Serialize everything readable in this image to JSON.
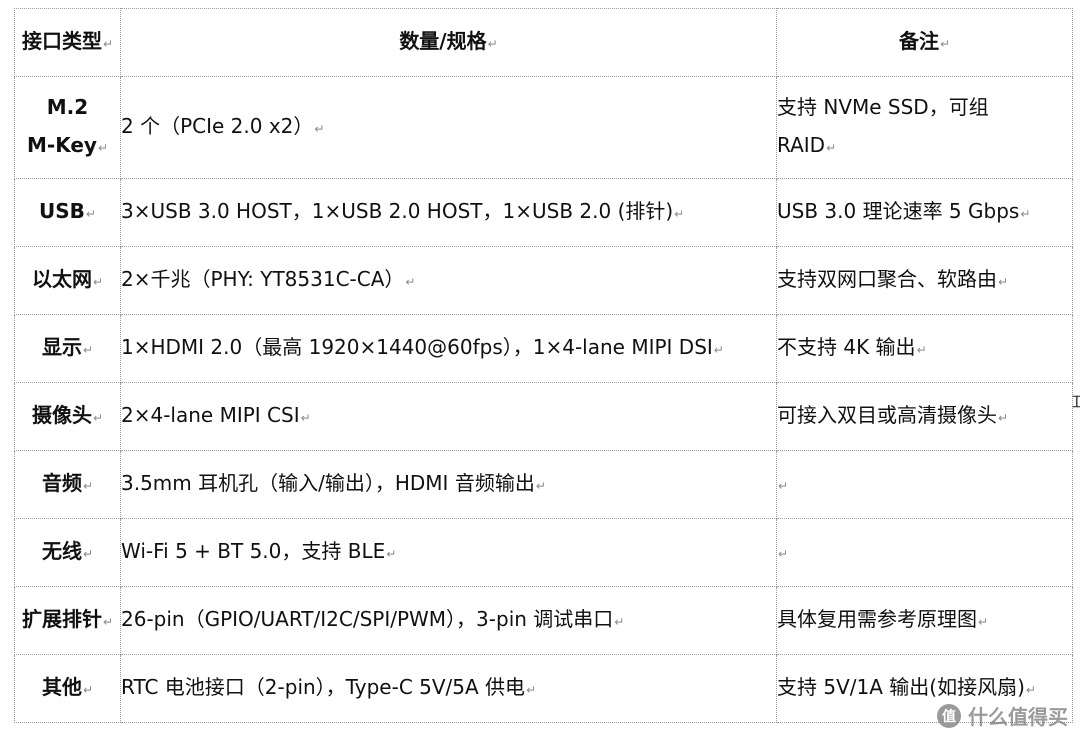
{
  "table": {
    "headers": [
      "接口类型",
      "数量/规格",
      "备注"
    ],
    "paragraph_mark": "↵",
    "rows": [
      {
        "type_lines": [
          "M.2",
          "M-Key"
        ],
        "spec": "2 个（PCIe 2.0 x2）",
        "note_lines": [
          "支持 NVMe SSD，可组",
          "RAID"
        ]
      },
      {
        "type_lines": [
          "USB"
        ],
        "spec": "3×USB 3.0 HOST，1×USB 2.0 HOST，1×USB 2.0 (排针)",
        "note_lines": [
          "USB 3.0  理论速率 5 Gbps"
        ]
      },
      {
        "type_lines": [
          "以太网"
        ],
        "spec": "2×千兆（PHY: YT8531C-CA）",
        "note_lines": [
          "支持双网口聚合、软路由"
        ]
      },
      {
        "type_lines": [
          "显示"
        ],
        "spec": "1×HDMI 2.0（最高 1920×1440@60fps），1×4-lane MIPI DSI",
        "note_lines": [
          "不支持  4K  输出"
        ]
      },
      {
        "type_lines": [
          "摄像头"
        ],
        "spec": "2×4-lane MIPI CSI",
        "note_lines": [
          "可接入双目或高清摄像头"
        ]
      },
      {
        "type_lines": [
          "音频"
        ],
        "spec": "3.5mm  耳机孔（输入/输出），HDMI  音频输出",
        "note_lines": [
          ""
        ]
      },
      {
        "type_lines": [
          "无线"
        ],
        "spec": "Wi-Fi 5 + BT 5.0，支持  BLE",
        "note_lines": [
          ""
        ]
      },
      {
        "type_lines": [
          "扩展排针"
        ],
        "spec": "26-pin（GPIO/UART/I2C/SPI/PWM），3-pin  调试串口",
        "note_lines": [
          "具体复用需参考原理图"
        ]
      },
      {
        "type_lines": [
          "其他"
        ],
        "spec": "RTC  电池接口（2-pin），Type-C 5V/5A  供电",
        "note_lines": [
          "支持 5V/1A 输出(如接风扇)"
        ]
      }
    ]
  },
  "watermark": {
    "text": "什么值得买",
    "icon": "smzdm-logo-icon"
  },
  "colors": {
    "border": "#9a9a9a",
    "text": "#111111",
    "spellcheck": "#e03030"
  }
}
